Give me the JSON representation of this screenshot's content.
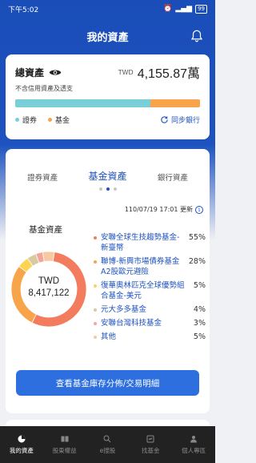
{
  "status_bar": {
    "time": "下午5:02",
    "battery": "99"
  },
  "header": {
    "title": "我的資產"
  },
  "total_assets": {
    "title": "總資產",
    "currency": "TWD",
    "amount": "4,155.87萬",
    "note": "不含信用資產及透支",
    "bar_segments": [
      {
        "name": "證券",
        "fraction": 0.73,
        "color": "#78cfd8"
      },
      {
        "name": "基金",
        "fraction": 0.27,
        "color": "#f7a44a"
      }
    ],
    "legend": [
      {
        "label": "證券",
        "color": "#78cfd8"
      },
      {
        "label": "基金",
        "color": "#f7a44a"
      }
    ],
    "sync_label": "同步銀行"
  },
  "asset_tabs": [
    {
      "label": "證券資產",
      "active": false
    },
    {
      "label": "基金資產",
      "active": true
    },
    {
      "label": "銀行資產",
      "active": false
    }
  ],
  "fund_panel": {
    "updated": "110/07/19 17:01 更新",
    "section_title": "基金資產",
    "currency": "TWD",
    "total": "8,417,122",
    "button_label": "查看基金庫存分佈/交易明細"
  },
  "chart_data": {
    "type": "pie",
    "categories": [
      "安聯全球生技趨勢基金-新臺幣",
      "聯博-新興市場債券基金A2股歐元避險",
      "復華奧林匹克全球優勢組合基金-美元",
      "元大多多基金",
      "安聯台灣科技基金",
      "其他"
    ],
    "values": [
      55,
      28,
      5,
      4,
      3,
      5
    ],
    "percent_labels": [
      "55%",
      "28%",
      "5%",
      "4%",
      "3%",
      "5%"
    ],
    "colors": [
      "#f47c5e",
      "#f7a44a",
      "#fcd451",
      "#d8c9a0",
      "#f4a59b",
      "#f7c9a1"
    ],
    "center_label": "TWD 8,417,122"
  },
  "tab_bar": [
    {
      "label": "我的資產",
      "icon": "pie-chart-icon",
      "active": true
    },
    {
      "label": "股東權益",
      "icon": "book-icon",
      "active": false
    },
    {
      "label": "e搜股",
      "icon": "search-stock-icon",
      "active": false
    },
    {
      "label": "找基金",
      "icon": "find-fund-icon",
      "active": false
    },
    {
      "label": "個人專區",
      "icon": "person-icon",
      "active": false
    }
  ],
  "colors": {
    "brand": "#1d52bf",
    "button": "#2e6fe0"
  }
}
